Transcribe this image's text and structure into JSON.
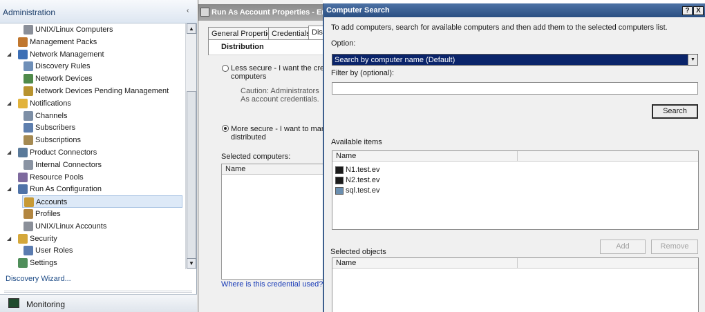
{
  "nav": {
    "title": "Administration",
    "collapse_glyph": "‹",
    "items": [
      {
        "label": "UNIX/Linux Computers",
        "icon": "unix-computers-icon",
        "level": 2,
        "expander": ""
      },
      {
        "label": "Management Packs",
        "icon": "management-packs-icon",
        "level": 1,
        "expander": ""
      },
      {
        "label": "Network Management",
        "icon": "network-management-icon",
        "level": 1,
        "expander": "◢"
      },
      {
        "label": "Discovery Rules",
        "icon": "discovery-rules-icon",
        "level": 2,
        "expander": ""
      },
      {
        "label": "Network Devices",
        "icon": "network-devices-icon",
        "level": 2,
        "expander": ""
      },
      {
        "label": "Network Devices Pending Management",
        "icon": "pending-devices-icon",
        "level": 2,
        "expander": ""
      },
      {
        "label": "Notifications",
        "icon": "notifications-icon",
        "level": 1,
        "expander": "◢"
      },
      {
        "label": "Channels",
        "icon": "channels-icon",
        "level": 2,
        "expander": ""
      },
      {
        "label": "Subscribers",
        "icon": "subscribers-icon",
        "level": 2,
        "expander": ""
      },
      {
        "label": "Subscriptions",
        "icon": "subscriptions-icon",
        "level": 2,
        "expander": ""
      },
      {
        "label": "Product Connectors",
        "icon": "product-connectors-icon",
        "level": 1,
        "expander": "◢"
      },
      {
        "label": "Internal Connectors",
        "icon": "internal-connectors-icon",
        "level": 2,
        "expander": ""
      },
      {
        "label": "Resource Pools",
        "icon": "resource-pools-icon",
        "level": 1,
        "expander": ""
      },
      {
        "label": "Run As Configuration",
        "icon": "run-as-configuration-icon",
        "level": 1,
        "expander": "◢"
      },
      {
        "label": "Accounts",
        "icon": "accounts-icon",
        "level": 2,
        "expander": "",
        "selected": true
      },
      {
        "label": "Profiles",
        "icon": "profiles-icon",
        "level": 2,
        "expander": ""
      },
      {
        "label": "UNIX/Linux Accounts",
        "icon": "unix-accounts-icon",
        "level": 2,
        "expander": ""
      },
      {
        "label": "Security",
        "icon": "security-icon",
        "level": 1,
        "expander": "◢"
      },
      {
        "label": "User Roles",
        "icon": "user-roles-icon",
        "level": 2,
        "expander": ""
      },
      {
        "label": "Settings",
        "icon": "settings-icon",
        "level": 1,
        "expander": ""
      }
    ],
    "wizard_link": "Discovery Wizard...",
    "monitoring": "Monitoring"
  },
  "props": {
    "title": "Run As Account Properties - Ent",
    "tabs": [
      "General Properties",
      "Credentials",
      "Dist"
    ],
    "section": "Distribution",
    "less_secure": [
      "Less secure - I want the crede",
      "computers"
    ],
    "caution": [
      "Caution: Administrators",
      "As account credentials."
    ],
    "more_secure": [
      "More secure - I want to manua",
      "distributed"
    ],
    "selected_label": "Selected computers:",
    "col_name": "Name",
    "link": "Where is this credential used?"
  },
  "dialog": {
    "title": "Computer Search",
    "help_btn": "?",
    "close_btn": "X",
    "instructions": "To add computers, search for available computers and then add them to the selected computers list.",
    "option_label": "Option:",
    "option_value": "Search by computer name (Default)",
    "filter_label": "Filter by (optional):",
    "filter_value": "",
    "search_btn": "Search",
    "available_label": "Available items",
    "col_name": "Name",
    "available_items": [
      {
        "name": "N1.test.ev",
        "icon": "server-icon"
      },
      {
        "name": "N2.test.ev",
        "icon": "server-icon"
      },
      {
        "name": "sql.test.ev",
        "icon": "computer-icon"
      }
    ],
    "add_btn": "Add",
    "remove_btn": "Remove",
    "selected_label": "Selected objects",
    "selected_col_name": "Name"
  },
  "colors": {
    "title_active": "#2a4f82",
    "selection": "#0a246a",
    "link": "#1639b6"
  }
}
